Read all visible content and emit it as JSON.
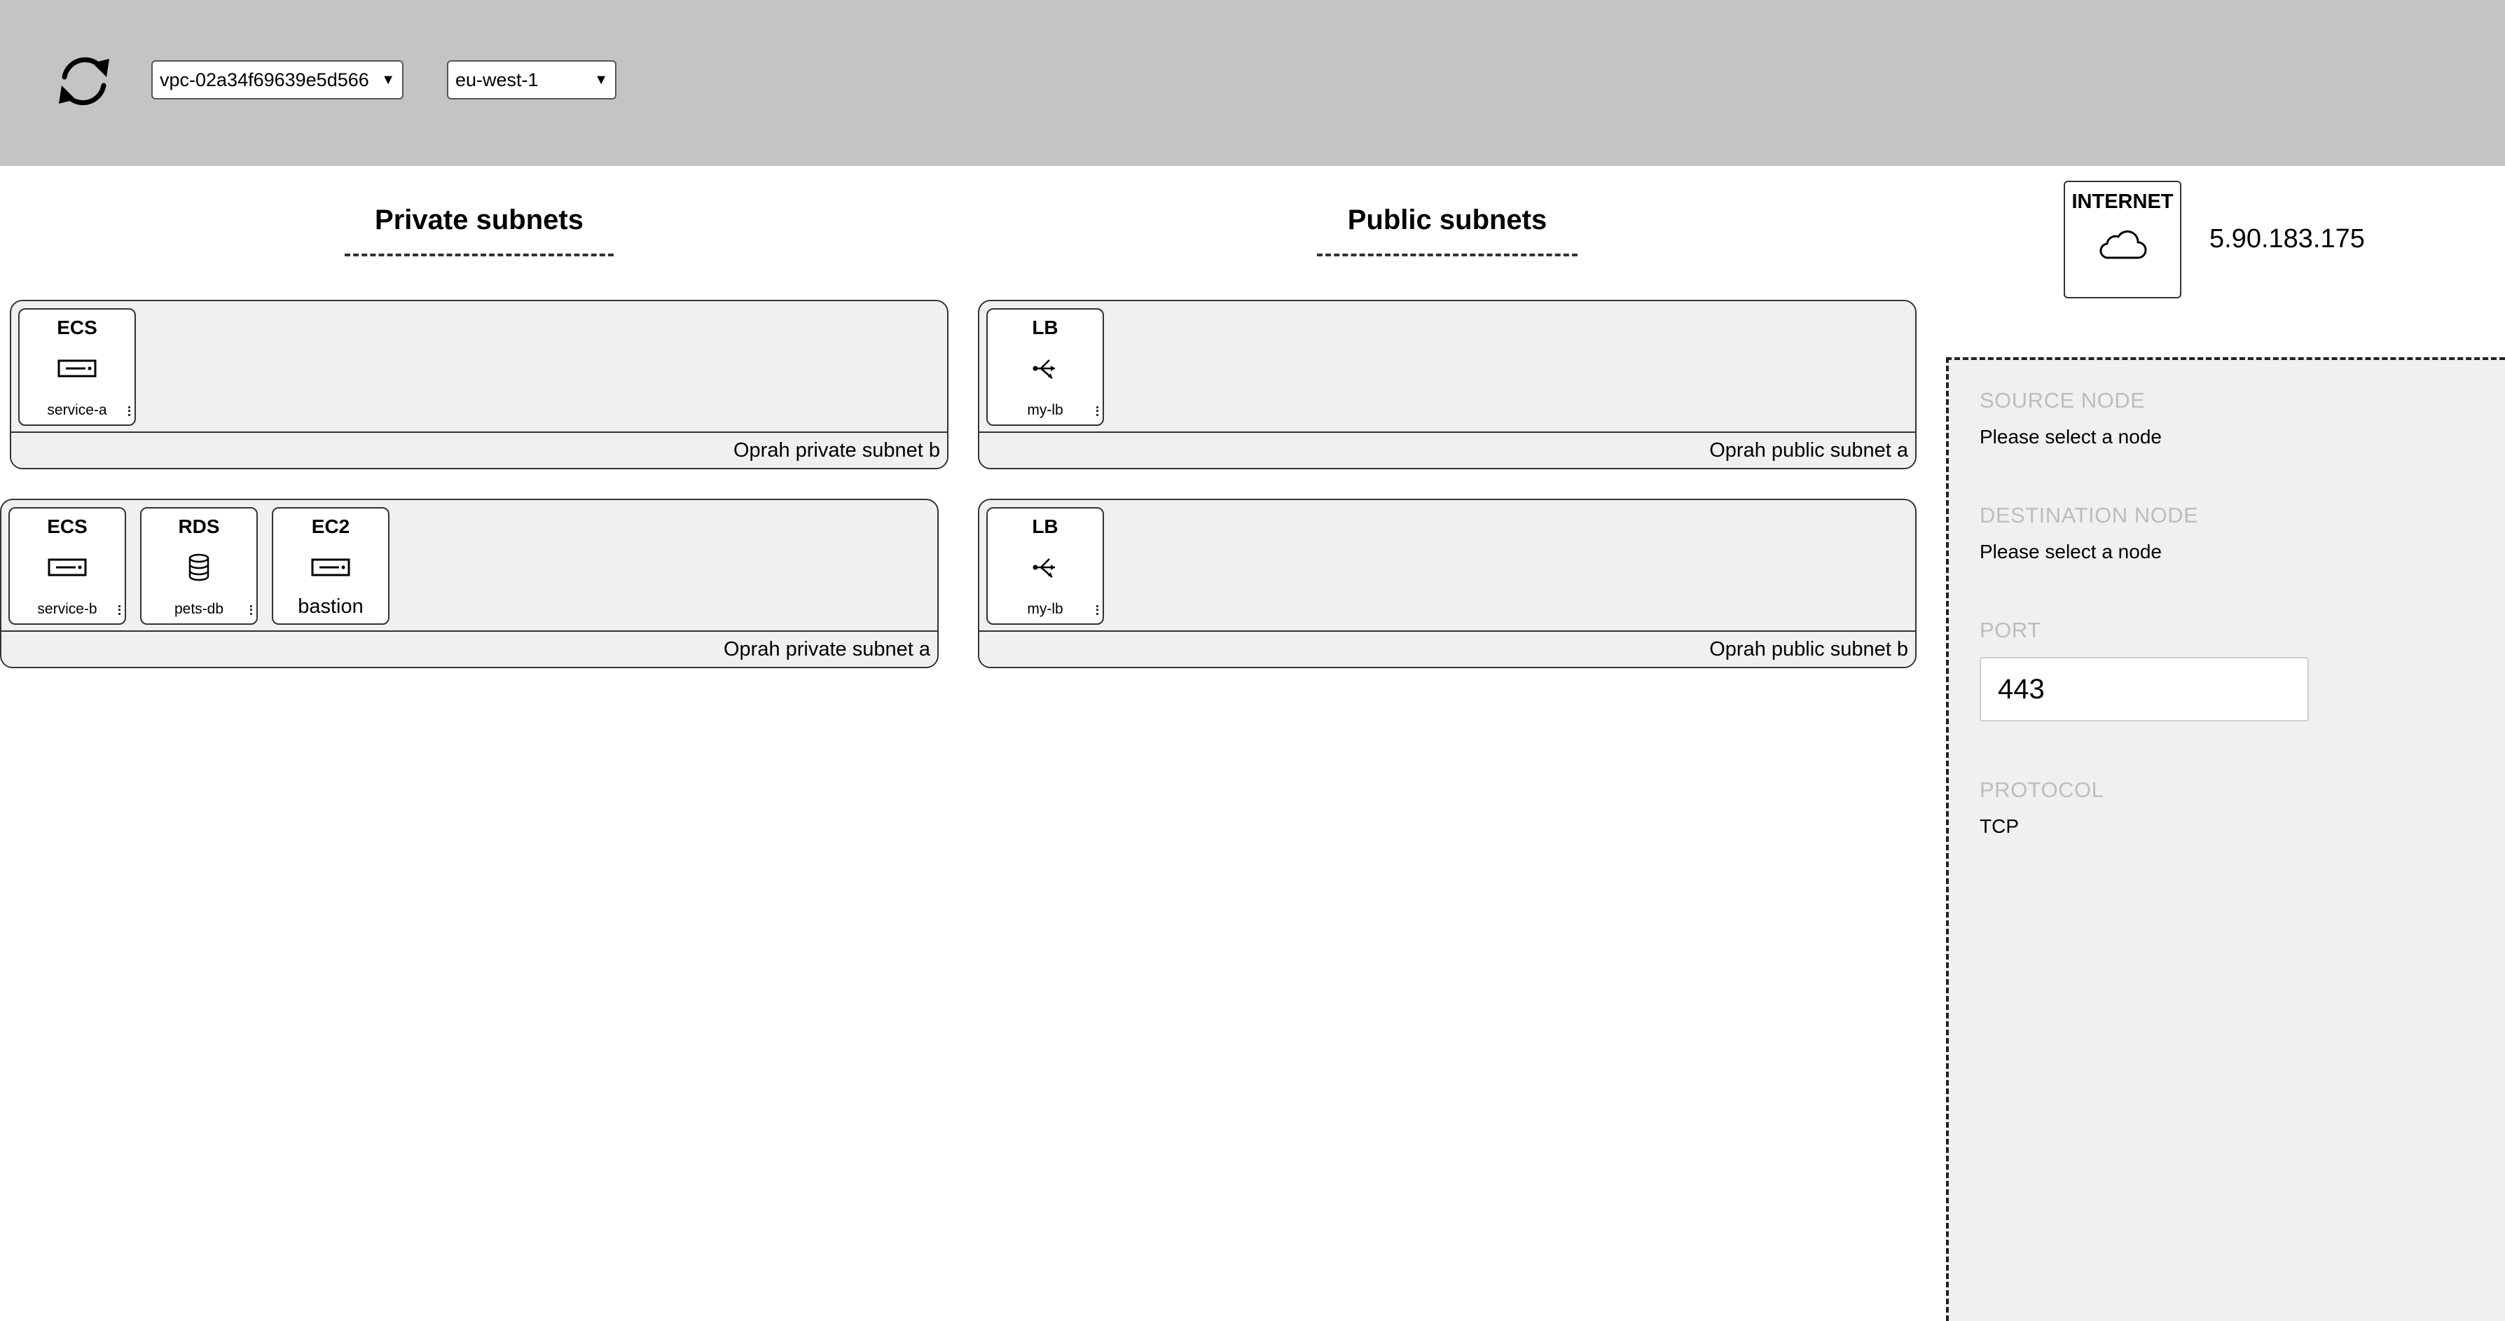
{
  "toolbar": {
    "refresh_icon": "refresh-icon",
    "vpc_selected": "vpc-02a34f69639e5d566",
    "region_selected": "eu-west-1"
  },
  "columns": {
    "private_title": "Private subnets",
    "public_title": "Public subnets"
  },
  "subnets": {
    "private_b": {
      "label": "Oprah private subnet b",
      "nodes": [
        {
          "type": "ECS",
          "name": "service-a",
          "icon": "server-icon"
        }
      ]
    },
    "private_a": {
      "label": "Oprah private subnet a",
      "nodes": [
        {
          "type": "ECS",
          "name": "service-b",
          "icon": "server-icon"
        },
        {
          "type": "RDS",
          "name": "pets-db",
          "icon": "database-icon"
        },
        {
          "type": "EC2",
          "name": "bastion",
          "icon": "server-icon"
        }
      ]
    },
    "public_a": {
      "label": "Oprah public subnet a",
      "nodes": [
        {
          "type": "LB",
          "name": "my-lb",
          "icon": "load-balancer-icon"
        }
      ]
    },
    "public_b": {
      "label": "Oprah public subnet b",
      "nodes": [
        {
          "type": "LB",
          "name": "my-lb",
          "icon": "load-balancer-icon"
        }
      ]
    }
  },
  "internet": {
    "label": "INTERNET",
    "icon": "cloud-icon",
    "ip": "5.90.183.175"
  },
  "panel": {
    "source_label": "SOURCE NODE",
    "source_value": "Please select a node",
    "destination_label": "DESTINATION NODE",
    "destination_value": "Please select a node",
    "port_label": "PORT",
    "port_value": "443",
    "protocol_label": "PROTOCOL",
    "protocol_value": "TCP"
  }
}
